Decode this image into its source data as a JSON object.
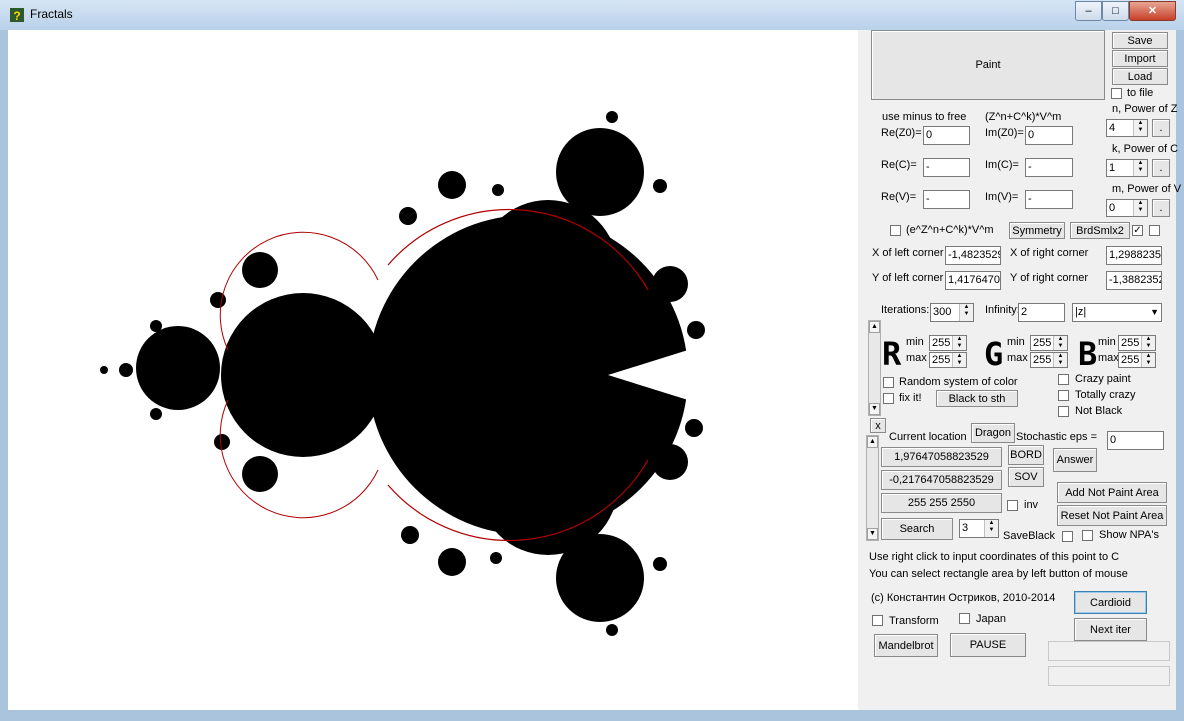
{
  "window": {
    "title": "Fractals",
    "controls": [
      "–",
      "□",
      "✕"
    ]
  },
  "top": {
    "paint": "Paint",
    "save": "Save",
    "import": "Import",
    "load": "Load",
    "to_file": "to file"
  },
  "params": {
    "hint": "use minus to free",
    "formula": "(Z^n+C^k)*V^m",
    "re_z0_label": "Re(Z0)=",
    "re_z0": "0",
    "im_z0_label": "Im(Z0)=",
    "im_z0": "0",
    "re_c_label": "Re(C)=",
    "re_c": "-",
    "im_c_label": "Im(C)=",
    "im_c": "-",
    "re_v_label": "Re(V)=",
    "re_v": "-",
    "im_v_label": "Im(V)=",
    "im_v": "-",
    "n_label": "n, Power of Z",
    "n": "4",
    "k_label": "k, Power of C",
    "k": "1",
    "m_label": "m, Power of V",
    "m": "0",
    "dot": "."
  },
  "exp_row": {
    "exp_label": "(e^Z^n+C^k)*V^m",
    "symmetry": "Symmetry",
    "brd": "BrdSmlx2"
  },
  "corners": {
    "xl_label": "X of left corner",
    "xl": "-1,4823529",
    "xr_label": "X of right corner",
    "xr": "1,2988235",
    "yl_label": "Y of left corner",
    "yl": "1,4176470",
    "yr_label": "Y of right corner",
    "yr": "-1,3882352"
  },
  "iter": {
    "iterations_label": "Iterations:",
    "iterations": "300",
    "infinity_label": "Infinity:",
    "infinity": "2",
    "norm": "|z|"
  },
  "colors": {
    "r": "R",
    "g": "G",
    "b": "B",
    "min": "min",
    "max": "max",
    "r_min": "255",
    "r_max": "255",
    "g_min": "255",
    "g_max": "255",
    "b_min": "255",
    "b_max": "255",
    "random": "Random system of color",
    "fix": "fix it!",
    "black_to": "Black to sth",
    "crazy": "Crazy paint",
    "totally": "Totally crazy",
    "not_black": "Not Black"
  },
  "location": {
    "x": "x",
    "current": "Current location",
    "dragon": "Dragon",
    "stochastic": "Stochastic eps =",
    "stochastic_val": "0",
    "coord_x": "1,97647058823529",
    "bord": "BORD",
    "answer": "Answer",
    "coord_y": "-0,217647058823529",
    "sov": "SOV",
    "rgb": "255 255 2550",
    "inv": "inv",
    "add_npa": "Add Not Paint Area",
    "reset_npa": "Reset Not Paint Area",
    "search": "Search",
    "search_val": "3",
    "saveblack": "SaveBlack",
    "show_npa": "Show NPA's"
  },
  "info": {
    "line1": "Use right click to input coordinates of this point to C",
    "line2": "You can select rectangle area by left button of mouse",
    "copyright": "(c) Константин Остриков, 2010-2014",
    "cardioid": "Cardioid",
    "transform": "Transform",
    "japan": "Japan",
    "next_iter": "Next iter",
    "mandelbrot": "Mandelbrot",
    "pause": "PAUSE"
  },
  "colors_hex": {
    "fractal": "#000000",
    "border": "#b00000",
    "panel": "#f0f0f0",
    "frame": "#aac4dd"
  }
}
